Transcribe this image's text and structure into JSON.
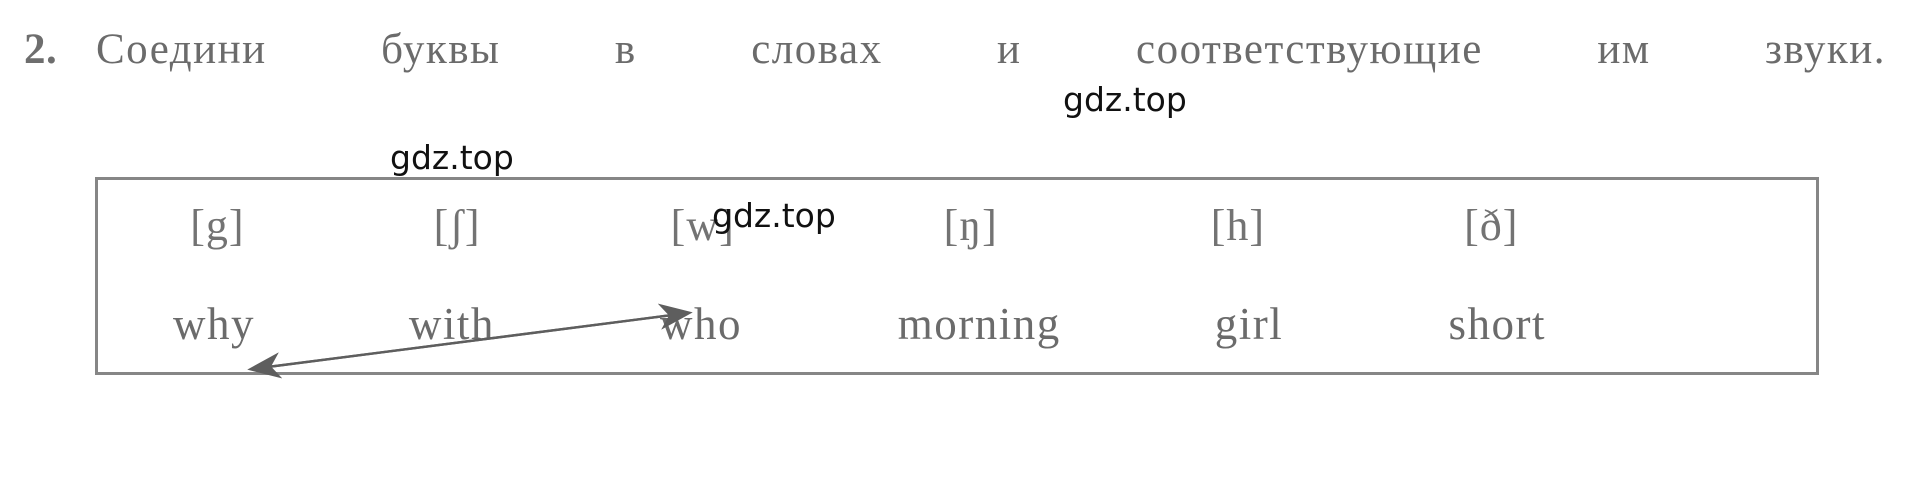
{
  "task": {
    "number": "2.",
    "instruction": "Соедини буквы в словах и соответствующие им звуки."
  },
  "exercise": {
    "sounds": [
      {
        "label": "[g]"
      },
      {
        "label": "[ʃ]"
      },
      {
        "label": "[w]"
      },
      {
        "label": "[ŋ]"
      },
      {
        "label": "[h]"
      },
      {
        "label": "[ð]"
      }
    ],
    "words": [
      {
        "label": "why"
      },
      {
        "label": "with"
      },
      {
        "label": "who"
      },
      {
        "label": "morning"
      },
      {
        "label": "girl"
      },
      {
        "label": "short"
      }
    ],
    "connections": [
      {
        "from_word": "why",
        "to_sound": "[w]",
        "style": "double-headed-arrow"
      }
    ]
  },
  "watermarks": [
    {
      "text": "gdz.top"
    },
    {
      "text": "gdz.top"
    },
    {
      "text": "gdz.top"
    }
  ],
  "colors": {
    "ink": "#6b6b6b",
    "box_border": "#868686",
    "arrow": "#5e5e5e",
    "watermark": "#111111",
    "page_background": "#ffffff"
  }
}
